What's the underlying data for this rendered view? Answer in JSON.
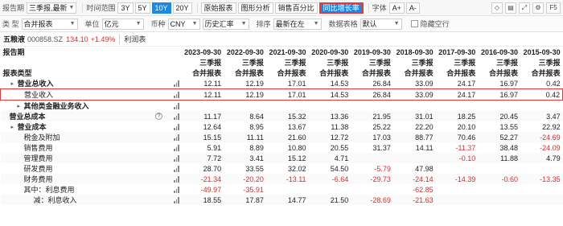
{
  "toolbar1": {
    "report_period_label": "报告期",
    "report_period_value": "三季报,最新",
    "time_range_label": "时间范围",
    "ranges": [
      "3Y",
      "5Y",
      "10Y",
      "20Y"
    ],
    "active_range": "10Y",
    "view_buttons": [
      "原始报表",
      "图形分析",
      "销售百分比",
      "同比增长率"
    ],
    "highlighted_button": "同比增长率",
    "font_label": "字体",
    "font_up": "A+",
    "font_down": "A-",
    "f5": "F5"
  },
  "toolbar2": {
    "type_label": "类 型",
    "type_value": "合并报表",
    "unit_label": "单位",
    "unit_value": "亿元",
    "currency_label": "币种",
    "currency_value": "CNY",
    "rate_value": "历史汇率",
    "sort_label": "排序",
    "sort_value": "最新在左",
    "table_label": "数据表格",
    "table_value": "默认",
    "hide_empty": "隐藏空行"
  },
  "stock": {
    "name": "五粮液",
    "code": "000858.SZ",
    "price": "134.10",
    "change": "+1.49%",
    "tab": "利润表"
  },
  "header": {
    "row1_label": "报告期",
    "row2_label": "报表类型",
    "periods": [
      "2023-09-30",
      "2022-09-30",
      "2021-09-30",
      "2020-09-30",
      "2019-09-30",
      "2018-09-30",
      "2017-09-30",
      "2016-09-30",
      "2015-09-30"
    ],
    "quarter": [
      "三季报",
      "三季报",
      "三季报",
      "三季报",
      "三季报",
      "三季报",
      "三季报",
      "三季报",
      "三季报"
    ],
    "report_type": [
      "合并报表",
      "合并报表",
      "合并报表",
      "合并报表",
      "合并报表",
      "合并报表",
      "合并报表",
      "合并报表",
      "合并报表"
    ]
  },
  "rows": [
    {
      "label": "营业总收入",
      "caret": "▸",
      "bold": true,
      "indent": 1,
      "bars": true,
      "values": [
        "12.11",
        "12.19",
        "17.01",
        "14.53",
        "26.84",
        "33.09",
        "24.17",
        "16.97",
        "0.42"
      ]
    },
    {
      "label": "营业收入",
      "caret": "",
      "bold": false,
      "indent": 2,
      "bars": true,
      "selected": true,
      "values": [
        "12.11",
        "12.19",
        "17.01",
        "14.53",
        "26.84",
        "33.09",
        "24.17",
        "16.97",
        "0.42"
      ]
    },
    {
      "label": "其他类金融业务收入",
      "caret": "▸",
      "bold": true,
      "indent": 2,
      "bars": true,
      "values": [
        "",
        "",
        "",
        "",
        "",
        "",
        "",
        "",
        ""
      ]
    },
    {
      "label": "营业总成本",
      "caret": "",
      "bold": true,
      "indent": 0,
      "help": true,
      "bars": true,
      "values": [
        "11.17",
        "8.64",
        "15.32",
        "13.36",
        "21.95",
        "31.01",
        "18.25",
        "20.45",
        "3.47"
      ]
    },
    {
      "label": "营业成本",
      "caret": "▸",
      "bold": true,
      "indent": 1,
      "bars": true,
      "values": [
        "12.64",
        "8.95",
        "13.67",
        "11.38",
        "25.22",
        "22.20",
        "20.10",
        "13.55",
        "22.92"
      ]
    },
    {
      "label": "税金及附加",
      "caret": "",
      "bold": false,
      "indent": 2,
      "bars": true,
      "values": [
        "15.15",
        "11.11",
        "21.60",
        "12.72",
        "17.03",
        "88.77",
        "70.46",
        "52.27",
        "-24.69"
      ]
    },
    {
      "label": "销售费用",
      "caret": "",
      "bold": false,
      "indent": 2,
      "bars": true,
      "values": [
        "5.91",
        "8.89",
        "10.80",
        "20.55",
        "31.37",
        "14.11",
        "-11.37",
        "38.48",
        "-24.09"
      ]
    },
    {
      "label": "管理费用",
      "caret": "",
      "bold": false,
      "indent": 2,
      "bars": true,
      "values": [
        "7.72",
        "3.41",
        "15.12",
        "4.71",
        "",
        "",
        "-0.10",
        "11.88",
        "4.79"
      ]
    },
    {
      "label": "研发费用",
      "caret": "",
      "bold": false,
      "indent": 2,
      "bars": true,
      "values": [
        "28.70",
        "33.55",
        "32.02",
        "54.50",
        "-5.79",
        "47.98",
        "",
        "",
        ""
      ]
    },
    {
      "label": "财务费用",
      "caret": "",
      "bold": false,
      "indent": 2,
      "bars": true,
      "values": [
        "-21.34",
        "-20.20",
        "-13.11",
        "-6.64",
        "-29.73",
        "-24.14",
        "-14.39",
        "-0.60",
        "-13.35"
      ]
    },
    {
      "label": "其中：利息费用",
      "caret": "",
      "bold": false,
      "indent": 2,
      "bars": true,
      "values": [
        "-49.97",
        "-35.91",
        "",
        "",
        "",
        "-62.85",
        "",
        "",
        ""
      ]
    },
    {
      "label": "减：利息收入",
      "caret": "",
      "bold": false,
      "indent": 3,
      "bars": true,
      "values": [
        "18.55",
        "17.87",
        "14.77",
        "21.50",
        "-28.69",
        "-21.63",
        "",
        "",
        ""
      ]
    }
  ]
}
